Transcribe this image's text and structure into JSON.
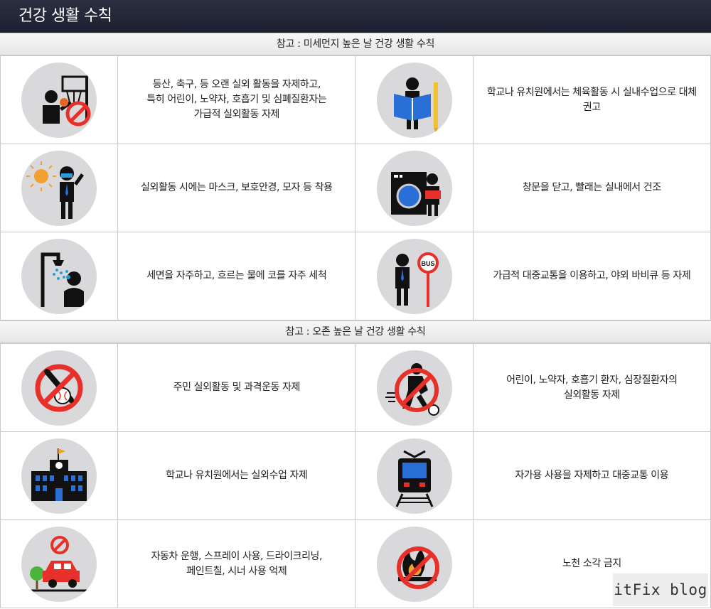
{
  "header": {
    "title": "건강 생활 수칙"
  },
  "sections": [
    {
      "title": "참고 : 미세먼지 높은 날 건강 생활 수칙",
      "rows": [
        [
          {
            "icon": "basketball-prohibited-icon",
            "text": "등산, 축구, 등 오랜 실외 활동을 자제하고,\n특히 어린이, 노약자, 호흡기 및 심폐질환자는\n가급적 실외활동 자제"
          },
          {
            "icon": "student-reading-icon",
            "text": "학교나 유치원에서는 체육활동 시 실내수업으로 대체 권고"
          }
        ],
        [
          {
            "icon": "masked-person-sun-icon",
            "text": "실외활동 시에는 마스크, 보호안경, 모자 등 착용"
          },
          {
            "icon": "washing-machine-icon",
            "text": "창문을 닫고, 빨래는 실내에서 건조"
          }
        ],
        [
          {
            "icon": "shower-icon",
            "text": "세면을 자주하고, 흐르는 물에 코를 자주 세척"
          },
          {
            "icon": "bus-stop-icon",
            "text": "가급적 대중교통을 이용하고, 야외 바비큐 등 자제"
          }
        ]
      ]
    },
    {
      "title": "참고 : 오존 높은 날 건강 생활 수칙",
      "rows": [
        [
          {
            "icon": "baseball-prohibited-icon",
            "text": "주민 실외활동 및 과격운동 자제"
          },
          {
            "icon": "soccer-prohibited-icon",
            "text": "어린이, 노약자, 호흡기 환자, 심장질환자의\n실외활동 자제"
          }
        ],
        [
          {
            "icon": "school-building-icon",
            "text": "학교나 유치원에서는 실외수업 자제"
          },
          {
            "icon": "train-icon",
            "text": "자가용 사용을 자제하고 대중교통 이용"
          }
        ],
        [
          {
            "icon": "car-prohibited-icon",
            "text": "자동차 운행, 스프레이 사용, 드라이크리닝,\n페인트칠, 시너 사용 억제"
          },
          {
            "icon": "fire-prohibited-icon",
            "text": "노천 소각 금지"
          }
        ]
      ]
    }
  ],
  "watermark": "itFix blog",
  "colors": {
    "header_bg": "#23273a",
    "icon_circle": "#d9d9db",
    "prohibit_red": "#e8302a",
    "accent_blue": "#2a6fd6"
  }
}
